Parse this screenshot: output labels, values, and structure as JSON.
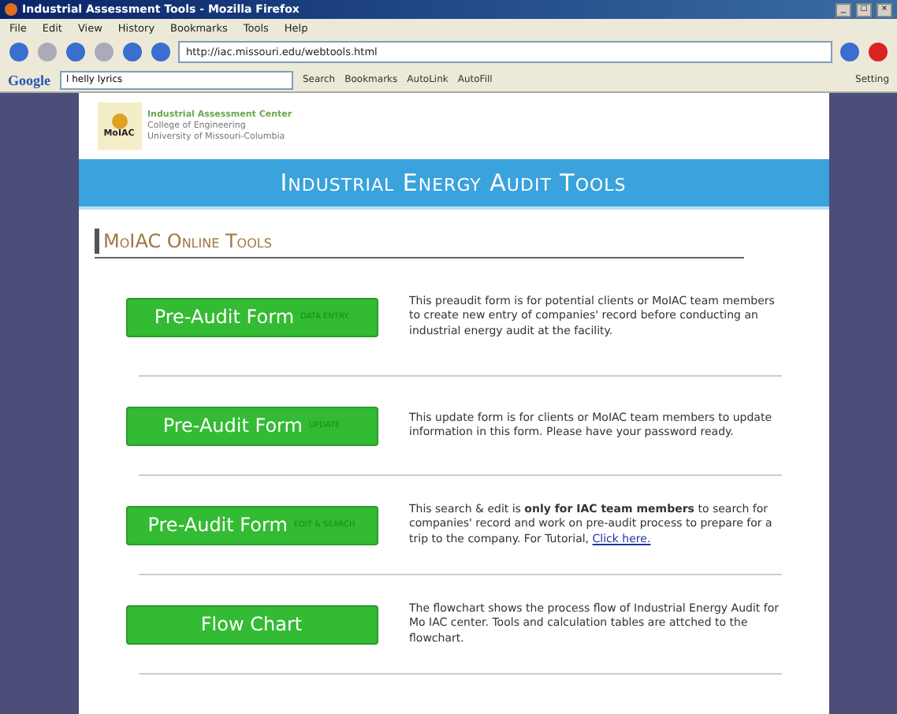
{
  "window": {
    "title": "Industrial Assessment Tools - Mozilla Firefox",
    "controls": [
      "_",
      "□",
      "×"
    ]
  },
  "menu": [
    "File",
    "Edit",
    "View",
    "History",
    "Bookmarks",
    "Tools",
    "Help"
  ],
  "address": {
    "value": "http://iac.missouri.edu/webtools.html"
  },
  "google_toolbar": {
    "brand": "Google",
    "query": "l helly lyrics",
    "items": [
      "Search",
      "Bookmarks",
      "AutoLink",
      "AutoFill"
    ],
    "settings": "Setting"
  },
  "logo": {
    "badge": "MoIAC",
    "lines": [
      "Industrial Assessment Center",
      "College of Engineering",
      "University of Missouri-Columbia"
    ]
  },
  "banner": "Industrial Energy Audit Tools",
  "section_title": "MoIAC Online Tools",
  "tools": [
    {
      "label": "Pre-Audit Form",
      "tag": "DATA ENTRY",
      "description": "This preaudit form is for potential clients or MoIAC team members to create new entry of companies' record before conducting an industrial energy audit at the facility."
    },
    {
      "label": "Pre-Audit Form",
      "tag": "UPDATE",
      "description": "This update form is for clients or MoIAC team members to update information in this form. Please have your password ready."
    },
    {
      "label": "Pre-Audit Form",
      "tag": "EDIT & SEARCH",
      "description": "This search & edit is **only for IAC team members** to search for companies' record and work on pre-audit process to prepare for a trip to the company. For Tutorial,",
      "link": "Click here."
    },
    {
      "label": "Flow Chart",
      "description": "The flowchart shows the process flow of Industrial Energy Audit for Mo IAC center. Tools and calculation tables are attched to the flowchart."
    }
  ]
}
